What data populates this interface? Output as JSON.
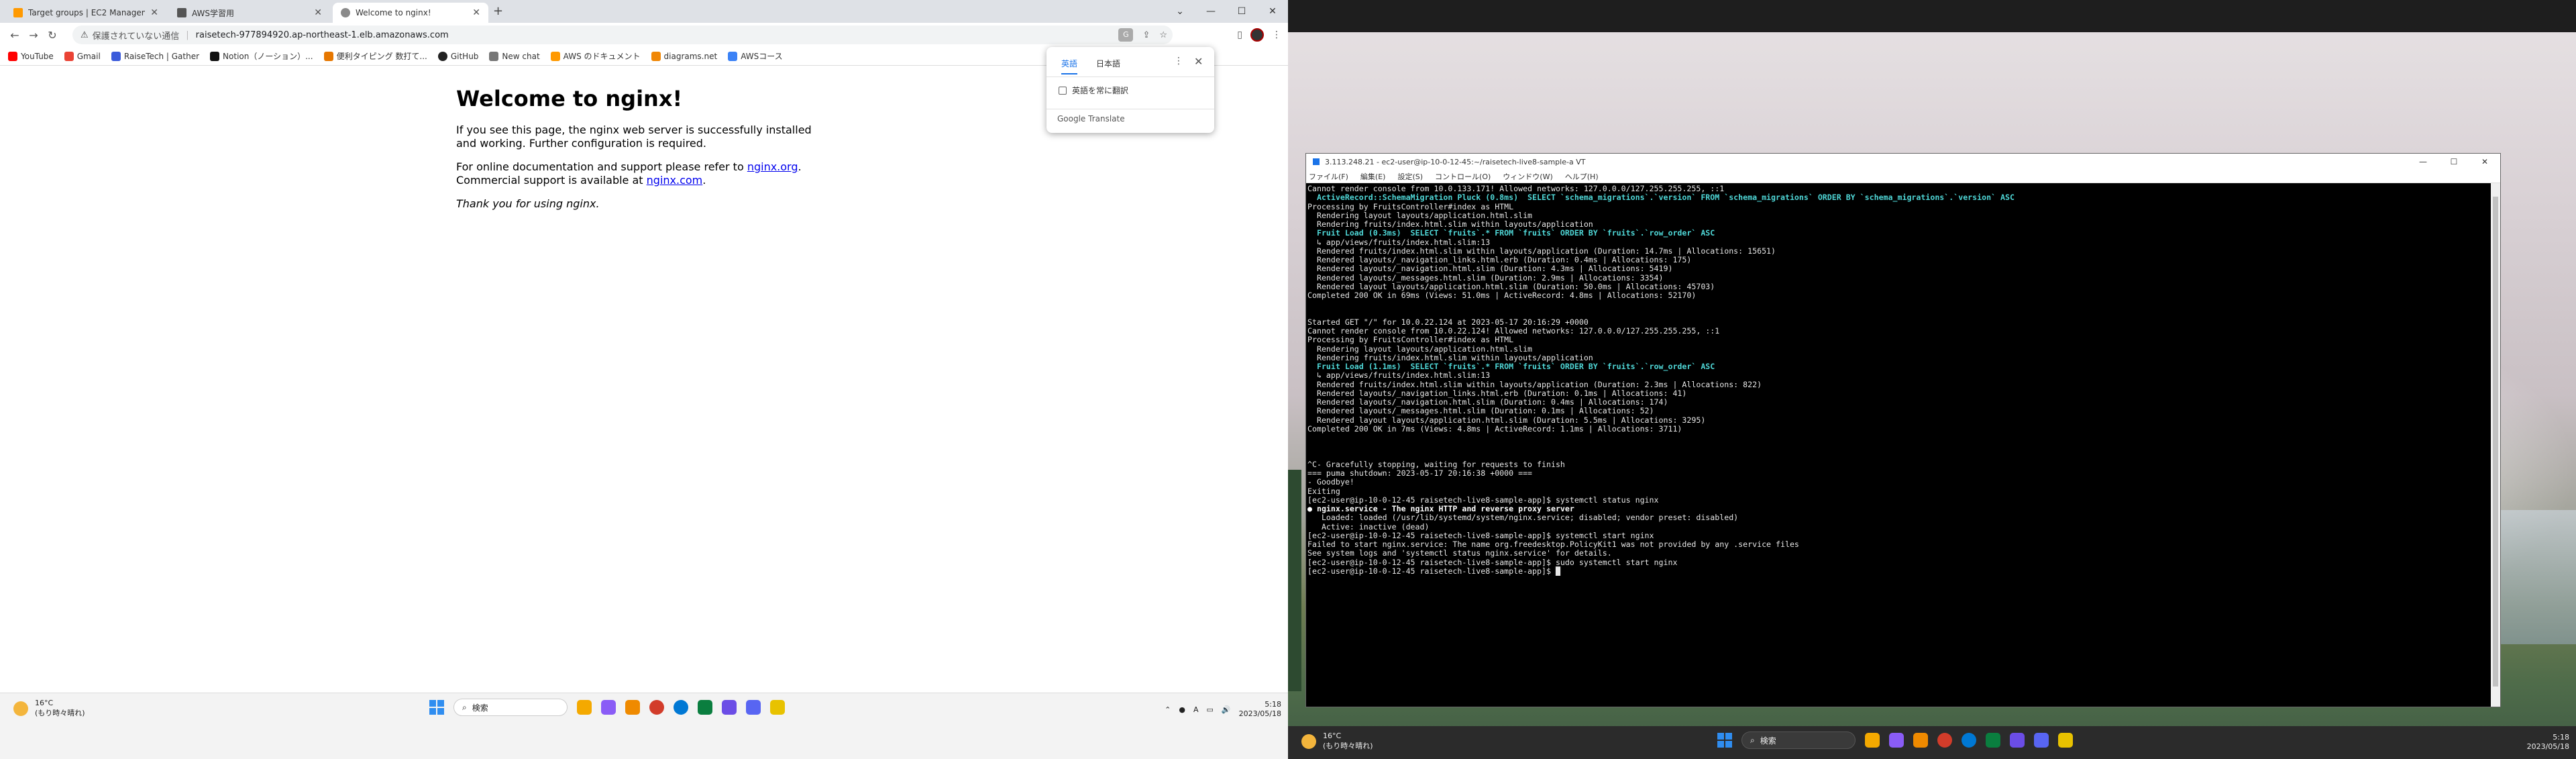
{
  "browser": {
    "tabs": [
      {
        "title": "Target groups | EC2 Managemen",
        "color": "#ff9900",
        "active": false
      },
      {
        "title": "AWS学習用",
        "color": "#555555",
        "active": false
      },
      {
        "title": "Welcome to nginx!",
        "color": "#8a8a8a",
        "active": true
      }
    ],
    "new_tab": "+",
    "window_controls": {
      "minimize": "—",
      "maximize": "☐",
      "close": "✕"
    },
    "nav": {
      "back": "←",
      "forward": "→",
      "reload": "↻"
    },
    "address": {
      "security_label": "保護されていない通信",
      "url": "raisetech-977894920.ap-northeast-1.elb.amazonaws.com"
    },
    "bookmarks": [
      {
        "label": "YouTube",
        "color": "#ff0000"
      },
      {
        "label": "Gmail",
        "color": "#ea4335"
      },
      {
        "label": "RaiseTech | Gather",
        "color": "#3b5bdb"
      },
      {
        "label": "Notion（ノーション）...",
        "color": "#111111"
      },
      {
        "label": "便利タイピング 数打て...",
        "color": "#e67700"
      },
      {
        "label": "GitHub",
        "color": "#222222"
      },
      {
        "label": "New chat",
        "color": "#777777"
      },
      {
        "label": "AWS のドキュメント",
        "color": "#ff9900"
      },
      {
        "label": "diagrams.net",
        "color": "#f08705"
      },
      {
        "label": "AWSコース",
        "color": "#3b82f6"
      }
    ]
  },
  "nginx_page": {
    "heading": "Welcome to nginx!",
    "p1": "If you see this page, the nginx web server is successfully installed and working. Further configuration is required.",
    "p2_prefix": "For online documentation and support please refer to",
    "p2_link1": "nginx.org",
    "p2_mid": "Commercial support is available at",
    "p2_link2": "nginx.com",
    "p3": "Thank you for using nginx."
  },
  "translate_popup": {
    "tab_en": "英語",
    "tab_ja": "日本語",
    "more": "⋮",
    "close": "✕",
    "checkbox_label": "英語を常に翻訳",
    "brand": "Google Translate"
  },
  "terminal": {
    "title": "3.113.248.21 - ec2-user@ip-10-0-12-45:~/raisetech-live8-sample-a VT",
    "menu": [
      "ファイル(F)",
      "編集(E)",
      "設定(S)",
      "コントロール(O)",
      "ウィンドウ(W)",
      "ヘルプ(H)"
    ],
    "lines": [
      {
        "t": "Cannot render console from 10.0.133.171! Allowed networks: 127.0.0.0/127.255.255.255, ::1",
        "c": ""
      },
      {
        "t": "  ActiveRecord::SchemaMigration Pluck (0.8ms)  SELECT `schema_migrations`.`version` FROM `schema_migrations` ORDER BY `schema_migrations`.`version` ASC",
        "c": "c-cyan"
      },
      {
        "t": "Processing by FruitsController#index as HTML",
        "c": ""
      },
      {
        "t": "  Rendering layout layouts/application.html.slim",
        "c": ""
      },
      {
        "t": "  Rendering fruits/index.html.slim within layouts/application",
        "c": ""
      },
      {
        "t": "  Fruit Load (0.3ms)  SELECT `fruits`.* FROM `fruits` ORDER BY `fruits`.`row_order` ASC",
        "c": "c-cyan"
      },
      {
        "t": "  ↳ app/views/fruits/index.html.slim:13",
        "c": ""
      },
      {
        "t": "  Rendered fruits/index.html.slim within layouts/application (Duration: 14.7ms | Allocations: 15651)",
        "c": ""
      },
      {
        "t": "  Rendered layouts/_navigation_links.html.erb (Duration: 0.4ms | Allocations: 175)",
        "c": ""
      },
      {
        "t": "  Rendered layouts/_navigation.html.slim (Duration: 4.3ms | Allocations: 5419)",
        "c": ""
      },
      {
        "t": "  Rendered layouts/_messages.html.slim (Duration: 2.9ms | Allocations: 3354)",
        "c": ""
      },
      {
        "t": "  Rendered layout layouts/application.html.slim (Duration: 50.0ms | Allocations: 45703)",
        "c": ""
      },
      {
        "t": "Completed 200 OK in 69ms (Views: 51.0ms | ActiveRecord: 4.8ms | Allocations: 52170)",
        "c": ""
      },
      {
        "t": "",
        "c": ""
      },
      {
        "t": "",
        "c": ""
      },
      {
        "t": "Started GET \"/\" for 10.0.22.124 at 2023-05-17 20:16:29 +0000",
        "c": ""
      },
      {
        "t": "Cannot render console from 10.0.22.124! Allowed networks: 127.0.0.0/127.255.255.255, ::1",
        "c": ""
      },
      {
        "t": "Processing by FruitsController#index as HTML",
        "c": ""
      },
      {
        "t": "  Rendering layout layouts/application.html.slim",
        "c": ""
      },
      {
        "t": "  Rendering fruits/index.html.slim within layouts/application",
        "c": ""
      },
      {
        "t": "  Fruit Load (1.1ms)  SELECT `fruits`.* FROM `fruits` ORDER BY `fruits`.`row_order` ASC",
        "c": "c-cyan"
      },
      {
        "t": "  ↳ app/views/fruits/index.html.slim:13",
        "c": ""
      },
      {
        "t": "  Rendered fruits/index.html.slim within layouts/application (Duration: 2.3ms | Allocations: 822)",
        "c": ""
      },
      {
        "t": "  Rendered layouts/_navigation_links.html.erb (Duration: 0.1ms | Allocations: 41)",
        "c": ""
      },
      {
        "t": "  Rendered layouts/_navigation.html.slim (Duration: 0.4ms | Allocations: 174)",
        "c": ""
      },
      {
        "t": "  Rendered layouts/_messages.html.slim (Duration: 0.1ms | Allocations: 52)",
        "c": ""
      },
      {
        "t": "  Rendered layout layouts/application.html.slim (Duration: 5.5ms | Allocations: 3295)",
        "c": ""
      },
      {
        "t": "Completed 200 OK in 7ms (Views: 4.8ms | ActiveRecord: 1.1ms | Allocations: 3711)",
        "c": ""
      },
      {
        "t": "",
        "c": ""
      },
      {
        "t": "",
        "c": ""
      },
      {
        "t": "",
        "c": ""
      },
      {
        "t": "^C- Gracefully stopping, waiting for requests to finish",
        "c": ""
      },
      {
        "t": "=== puma shutdown: 2023-05-17 20:16:38 +0000 ===",
        "c": ""
      },
      {
        "t": "- Goodbye!",
        "c": ""
      },
      {
        "t": "Exiting",
        "c": ""
      },
      {
        "t": "[ec2-user@ip-10-0-12-45 raisetech-live8-sample-app]$ systemctl status nginx",
        "c": ""
      },
      {
        "t": "● nginx.service - The nginx HTTP and reverse proxy server",
        "c": "c-bold"
      },
      {
        "t": "   Loaded: loaded (/usr/lib/systemd/system/nginx.service; disabled; vendor preset: disabled)",
        "c": ""
      },
      {
        "t": "   Active: inactive (dead)",
        "c": ""
      },
      {
        "t": "[ec2-user@ip-10-0-12-45 raisetech-live8-sample-app]$ systemctl start nginx",
        "c": ""
      },
      {
        "t": "Failed to start nginx.service: The name org.freedesktop.PolicyKit1 was not provided by any .service files",
        "c": ""
      },
      {
        "t": "See system logs and 'systemctl status nginx.service' for details.",
        "c": ""
      },
      {
        "t": "[ec2-user@ip-10-0-12-45 raisetech-live8-sample-app]$ sudo systemctl start nginx",
        "c": ""
      },
      {
        "t": "[ec2-user@ip-10-0-12-45 raisetech-live8-sample-app]$ █",
        "c": ""
      }
    ]
  },
  "taskbar": {
    "weather_temp": "16°C",
    "weather_desc": "(もり時々晴れ)",
    "search_label": "検索",
    "time": "5:18",
    "date": "2023/05/18",
    "app_colors": [
      "#f4a900",
      "#8a5cf6",
      "#ef8a00",
      "#0078d4",
      "#0a7e3f",
      "#d23c2a",
      "#6b4de6",
      "#e8c200"
    ]
  }
}
